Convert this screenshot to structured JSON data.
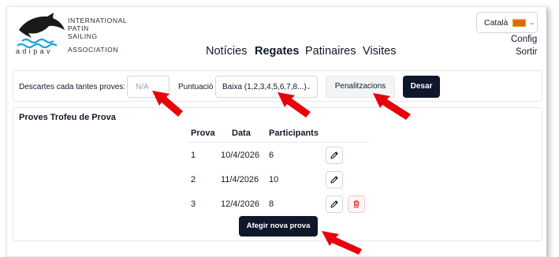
{
  "logo": {
    "lines": [
      "INTERNATIONAL",
      "PATIN",
      "SAILING",
      "ASSOCIATION"
    ],
    "adipav": "adipav"
  },
  "language": {
    "selected": "Català",
    "flag_icon": "catalonia-flag-icon"
  },
  "user_menu": {
    "config": "Config",
    "logout": "Sortir"
  },
  "nav": {
    "items": [
      {
        "label": "Notícies",
        "active": false
      },
      {
        "label": "Regates",
        "active": true
      },
      {
        "label": "Patinaires",
        "active": false
      },
      {
        "label": "Visites",
        "active": false
      }
    ]
  },
  "toolbar": {
    "discards_label": "Descartes cada tantes proves:",
    "discards_placeholder": "N/A",
    "scoring_label": "Puntuació",
    "scoring_value": "Baixa (1,2,3,4,5,6,7,8...)",
    "penalties_label": "Penalitzacions",
    "save_label": "Desar"
  },
  "races": {
    "title": "Proves Trofeu de Prova",
    "headers": [
      "Prova",
      "Data",
      "Participants"
    ],
    "rows": [
      {
        "prova": "1",
        "data": "10/4/2026",
        "participants": "6",
        "deletable": false
      },
      {
        "prova": "2",
        "data": "11/4/2026",
        "participants": "10",
        "deletable": false
      },
      {
        "prova": "3",
        "data": "12/4/2026",
        "participants": "8",
        "deletable": true
      }
    ],
    "add_label": "Afegir nova prova"
  },
  "colors": {
    "primary": "#0f172a",
    "annotation": "#e8000b",
    "danger": "#dc2626"
  }
}
